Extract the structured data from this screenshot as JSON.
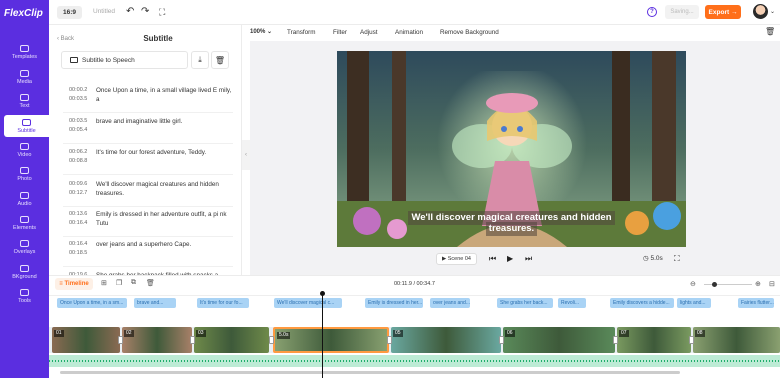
{
  "app": {
    "logo": "FlexClip",
    "ratio": "16:9",
    "title": "Untitled"
  },
  "header": {
    "help": "?",
    "saving": "Saving...",
    "export": "Export",
    "export_arrow": "→"
  },
  "nav": {
    "items": [
      {
        "label": "Templates",
        "icon": "templates-icon"
      },
      {
        "label": "Media",
        "icon": "media-icon"
      },
      {
        "label": "Text",
        "icon": "text-icon"
      },
      {
        "label": "Subtitle",
        "icon": "subtitle-icon",
        "active": true
      },
      {
        "label": "Video",
        "icon": "video-icon"
      },
      {
        "label": "Photo",
        "icon": "photo-icon"
      },
      {
        "label": "Audio",
        "icon": "audio-icon"
      },
      {
        "label": "Elements",
        "icon": "elements-icon"
      },
      {
        "label": "Overlays",
        "icon": "overlays-icon"
      },
      {
        "label": "BKground",
        "icon": "background-icon"
      },
      {
        "label": "Tools",
        "icon": "tools-icon"
      }
    ]
  },
  "panel": {
    "back": "Back",
    "title": "Subtitle",
    "tts_button": "Subtitle to Speech",
    "subtitles": [
      {
        "start": "00:00.2",
        "end": "00:03.5",
        "text": "Once Upon a time, in a small village lived E mily, a"
      },
      {
        "start": "00:03.5",
        "end": "00:05.4",
        "text": "brave and imaginative little girl."
      },
      {
        "start": "00:06.2",
        "end": "00:08.8",
        "text": "It's time for our forest adventure, Teddy."
      },
      {
        "start": "00:09.6",
        "end": "00:12.7",
        "text": "We'll discover magical creatures and hidden treasures."
      },
      {
        "start": "00:13.6",
        "end": "00:16.4",
        "text": "Emily is dressed in her adventure outfit, a pi nk Tutu"
      },
      {
        "start": "00:16.4",
        "end": "00:18.5",
        "text": "over jeans and a superhero Cape."
      },
      {
        "start": "00:19.6",
        "end": "",
        "text": "She grabs her backpack filled with snacks a"
      }
    ]
  },
  "editbar": {
    "zoom": "100%",
    "tools": [
      "Transform",
      "Filter",
      "Adjust",
      "Animation",
      "Remove Background"
    ]
  },
  "preview": {
    "caption_line1": "We'll discover magical creatures and hidden",
    "caption_line2": "treasures.",
    "scene": "Scene 04",
    "duration": "5.0s"
  },
  "timeline": {
    "label": "Timeline",
    "time": "00:11.9 / 00:34.7",
    "subtitle_chips": [
      "Once Upon a time, in a sm...",
      "brave and...",
      "It's time for our fo...",
      "We'll discover magical c...",
      "Emily is dressed in her...",
      "over jeans and...",
      "She grabs her back...",
      "Revoli...",
      "Emily discovers a hidde...",
      "lights and...",
      "Fairies flutter..."
    ],
    "clips": [
      {
        "label": "01",
        "color": "#8a6a52"
      },
      {
        "label": "02",
        "color": "#a88068"
      },
      {
        "label": "03",
        "color": "#6f8a4a"
      },
      {
        "label": "5.0s",
        "color": "#88a070"
      },
      {
        "label": "05",
        "color": "#6aa8a0"
      },
      {
        "label": "06",
        "color": "#5a8a5a"
      },
      {
        "label": "07",
        "color": "#7a9a60"
      },
      {
        "label": "08",
        "color": "#8aa070"
      }
    ]
  }
}
